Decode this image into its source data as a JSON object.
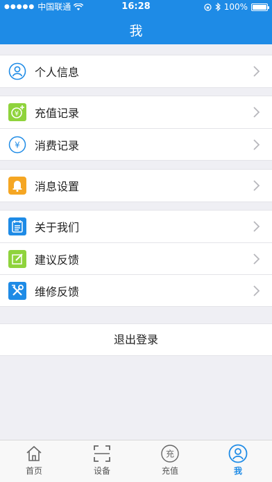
{
  "status_bar": {
    "carrier": "中国联通",
    "time": "16:28",
    "battery": "100%"
  },
  "header": {
    "title": "我"
  },
  "menu": {
    "profile": "个人信息",
    "recharge_records": "充值记录",
    "consumption_records": "消费记录",
    "message_settings": "消息设置",
    "about_us": "关于我们",
    "suggestion_feedback": "建议反馈",
    "repair_feedback": "维修反馈"
  },
  "logout_label": "退出登录",
  "tabs": [
    {
      "label": "首页",
      "icon": "home-icon"
    },
    {
      "label": "设备",
      "icon": "scan-icon"
    },
    {
      "label": "充值",
      "icon": "recharge-icon"
    },
    {
      "label": "我",
      "icon": "user-icon"
    }
  ],
  "colors": {
    "accent": "#1e8be6",
    "green": "#8fd33c",
    "orange": "#f5a623"
  }
}
